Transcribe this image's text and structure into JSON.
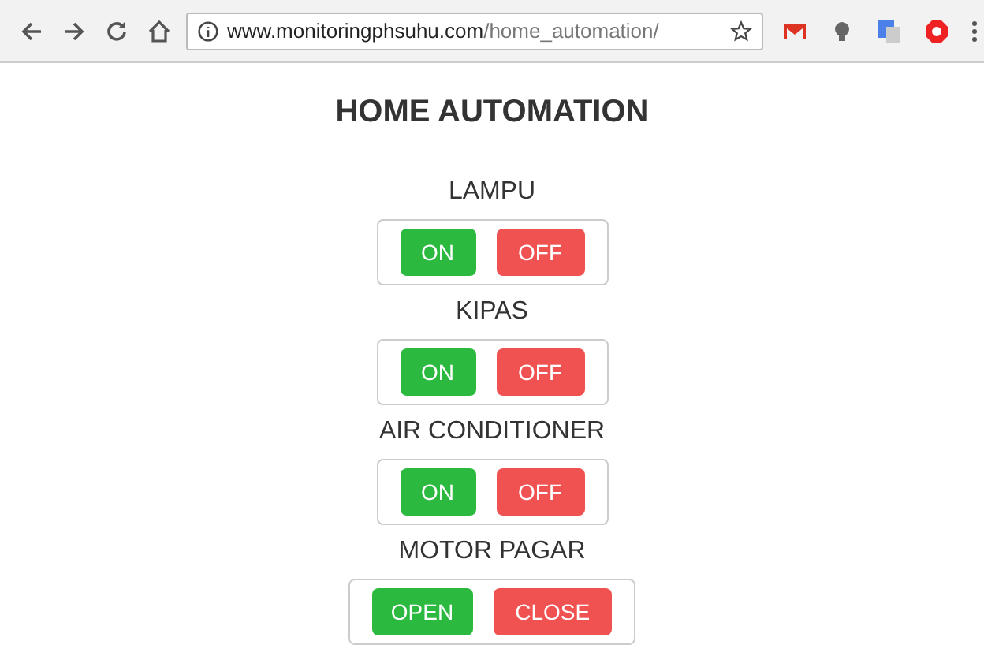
{
  "browser": {
    "url_host": "www.monitoringphsuhu.com",
    "url_path": "/home_automation/"
  },
  "title": "HOME AUTOMATION",
  "devices": [
    {
      "name": "LAMPU",
      "buttons": [
        {
          "label": "ON",
          "kind": "on"
        },
        {
          "label": "OFF",
          "kind": "off"
        }
      ]
    },
    {
      "name": "KIPAS",
      "buttons": [
        {
          "label": "ON",
          "kind": "on"
        },
        {
          "label": "OFF",
          "kind": "off"
        }
      ]
    },
    {
      "name": "AIR CONDITIONER",
      "buttons": [
        {
          "label": "ON",
          "kind": "on"
        },
        {
          "label": "OFF",
          "kind": "off"
        }
      ]
    },
    {
      "name": "MOTOR PAGAR",
      "buttons": [
        {
          "label": "OPEN",
          "kind": "on"
        },
        {
          "label": "CLOSE",
          "kind": "off"
        }
      ]
    }
  ]
}
